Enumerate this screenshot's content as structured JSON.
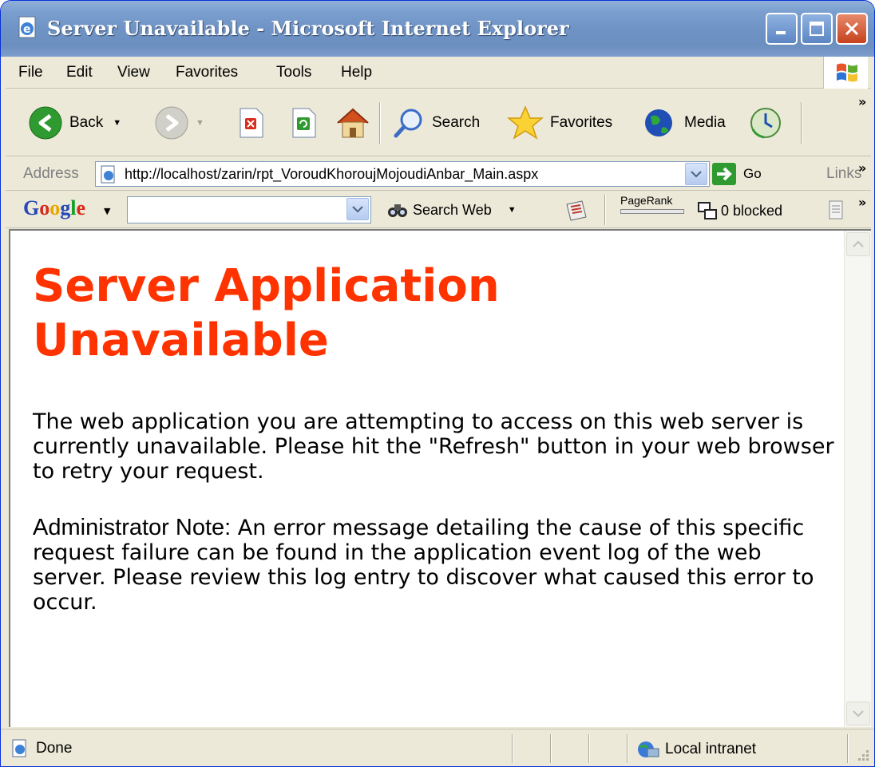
{
  "window": {
    "title": "Server Unavailable - Microsoft Internet Explorer"
  },
  "menu": {
    "file": "File",
    "edit": "Edit",
    "view": "View",
    "favorites": "Favorites",
    "tools": "Tools",
    "help": "Help"
  },
  "toolbar": {
    "back_label": "Back",
    "search_label": "Search",
    "favorites_label": "Favorites",
    "media_label": "Media"
  },
  "address": {
    "label": "Address",
    "url": "http://localhost/zarin/rpt_VoroudKhorouj​MojoudiAnbar_Main.aspx",
    "go_label": "Go",
    "links_label": "Links"
  },
  "google_toolbar": {
    "logo": "Google",
    "search_web_label": "Search Web",
    "pagerank_label": "PageRank",
    "blocked_label": "0 blocked",
    "search_value": ""
  },
  "page": {
    "heading": "Server Application Unavailable",
    "paragraph1": "The web application you are attempting to access on this web server is currently unavailable.  Please hit the \"Refresh\" button in your web browser to retry your request.",
    "note_label": "Administrator Note:",
    "note_text": " An error message detailing the cause of this specific request failure can be found in the application event log of the web server. Please review this log entry to discover what caused this error to occur."
  },
  "status": {
    "text": "Done",
    "zone": "Local intranet"
  }
}
